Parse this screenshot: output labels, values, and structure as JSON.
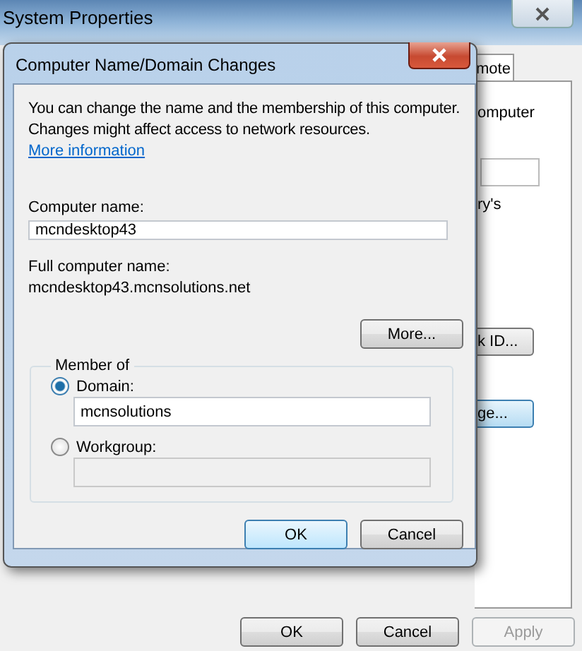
{
  "window": {
    "title": "System Properties",
    "tab_fragment": "mote",
    "text_fragment_1": "omputer",
    "text_fragment_2": "ry's",
    "button_fragment_1": "k ID...",
    "button_fragment_2": "ge...",
    "buttons": [
      {
        "label": "OK",
        "disabled": false
      },
      {
        "label": "Cancel",
        "disabled": false
      },
      {
        "label": "Apply",
        "disabled": true
      }
    ]
  },
  "dialog": {
    "title": "Computer Name/Domain Changes",
    "intro": "You can change the name and the membership of this computer. Changes might affect access to network resources.",
    "link": "More information",
    "computer_name_label": "Computer name:",
    "computer_name": "mcndesktop43",
    "full_name_label": "Full computer name:",
    "full_name": "mcndesktop43.mcnsolutions.net",
    "more_button": "More...",
    "group_label": "Member of",
    "options": [
      {
        "label": "Domain:",
        "selected": true,
        "value": "mcnsolutions"
      },
      {
        "label": "Workgroup:",
        "selected": false
      }
    ],
    "buttons": [
      {
        "label": "OK",
        "default": true
      },
      {
        "label": "Cancel",
        "default": false
      }
    ]
  }
}
